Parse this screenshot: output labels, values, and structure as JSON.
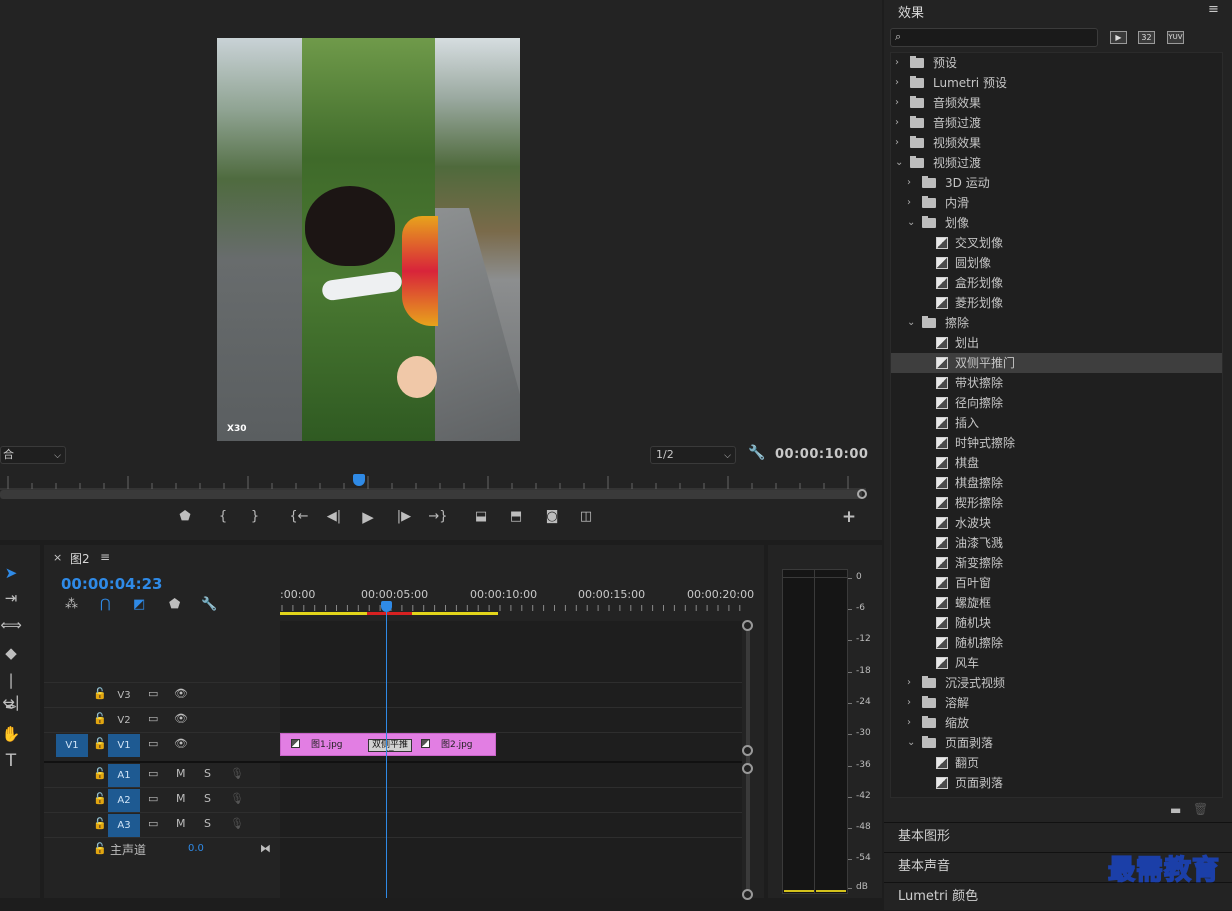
{
  "monitor": {
    "fit_value": "合",
    "resolution_value": "1/2",
    "duration_timecode": "00:00:10:00",
    "watermark": "X30"
  },
  "transport": {
    "buttons": [
      "marker-icon",
      "mark-in-icon",
      "mark-out-icon",
      "go-to-in-icon",
      "step-back-icon",
      "play-icon",
      "step-forward-icon",
      "go-to-out-icon",
      "lift-icon",
      "extract-icon",
      "export-frame-icon",
      "compare-view-icon",
      "add-button-icon"
    ]
  },
  "effects": {
    "title": "效果",
    "badges": [
      "32",
      "YUV"
    ],
    "tree": [
      {
        "label": "预设",
        "level": 0,
        "kind": "star-folder",
        "state": "closed"
      },
      {
        "label": "Lumetri 预设",
        "level": 0,
        "kind": "star-folder",
        "state": "closed"
      },
      {
        "label": "音频效果",
        "level": 0,
        "kind": "folder",
        "state": "closed"
      },
      {
        "label": "音频过渡",
        "level": 0,
        "kind": "folder",
        "state": "closed"
      },
      {
        "label": "视频效果",
        "level": 0,
        "kind": "folder",
        "state": "closed"
      },
      {
        "label": "视频过渡",
        "level": 0,
        "kind": "folder",
        "state": "open"
      },
      {
        "label": "3D 运动",
        "level": 1,
        "kind": "folder",
        "state": "closed"
      },
      {
        "label": "内滑",
        "level": 1,
        "kind": "folder",
        "state": "closed"
      },
      {
        "label": "划像",
        "level": 1,
        "kind": "folder",
        "state": "open"
      },
      {
        "label": "交叉划像",
        "level": 2,
        "kind": "fx"
      },
      {
        "label": "圆划像",
        "level": 2,
        "kind": "fx"
      },
      {
        "label": "盒形划像",
        "level": 2,
        "kind": "fx"
      },
      {
        "label": "菱形划像",
        "level": 2,
        "kind": "fx"
      },
      {
        "label": "擦除",
        "level": 1,
        "kind": "folder",
        "state": "open"
      },
      {
        "label": "划出",
        "level": 2,
        "kind": "fx"
      },
      {
        "label": "双侧平推门",
        "level": 2,
        "kind": "fx",
        "selected": true
      },
      {
        "label": "带状擦除",
        "level": 2,
        "kind": "fx"
      },
      {
        "label": "径向擦除",
        "level": 2,
        "kind": "fx"
      },
      {
        "label": "插入",
        "level": 2,
        "kind": "fx"
      },
      {
        "label": "时钟式擦除",
        "level": 2,
        "kind": "fx"
      },
      {
        "label": "棋盘",
        "level": 2,
        "kind": "fx"
      },
      {
        "label": "棋盘擦除",
        "level": 2,
        "kind": "fx"
      },
      {
        "label": "楔形擦除",
        "level": 2,
        "kind": "fx"
      },
      {
        "label": "水波块",
        "level": 2,
        "kind": "fx"
      },
      {
        "label": "油漆飞溅",
        "level": 2,
        "kind": "fx"
      },
      {
        "label": "渐变擦除",
        "level": 2,
        "kind": "fx"
      },
      {
        "label": "百叶窗",
        "level": 2,
        "kind": "fx"
      },
      {
        "label": "螺旋框",
        "level": 2,
        "kind": "fx"
      },
      {
        "label": "随机块",
        "level": 2,
        "kind": "fx"
      },
      {
        "label": "随机擦除",
        "level": 2,
        "kind": "fx"
      },
      {
        "label": "风车",
        "level": 2,
        "kind": "fx"
      },
      {
        "label": "沉浸式视频",
        "level": 1,
        "kind": "folder",
        "state": "closed"
      },
      {
        "label": "溶解",
        "level": 1,
        "kind": "folder",
        "state": "closed"
      },
      {
        "label": "缩放",
        "level": 1,
        "kind": "folder",
        "state": "closed"
      },
      {
        "label": "页面剥落",
        "level": 1,
        "kind": "folder",
        "state": "open"
      },
      {
        "label": "翻页",
        "level": 2,
        "kind": "fx"
      },
      {
        "label": "页面剥落",
        "level": 2,
        "kind": "fx"
      }
    ],
    "sections": [
      "基本图形",
      "基本声音",
      "Lumetri 颜色"
    ],
    "logo": "最需教育"
  },
  "timeline": {
    "sequence_name": "图2",
    "timecode": "00:00:04:23",
    "ruler_labels": [
      ":00:00",
      "00:00:05:00",
      "00:00:10:00",
      "00:00:15:00",
      "00:00:20:00"
    ],
    "video_tracks": [
      {
        "name": "V3",
        "source": ""
      },
      {
        "name": "V2",
        "source": ""
      },
      {
        "name": "V1",
        "source": "V1"
      }
    ],
    "audio_tracks": [
      {
        "name": "A1",
        "m": "M",
        "s": "S"
      },
      {
        "name": "A2",
        "m": "M",
        "s": "S"
      },
      {
        "name": "A3",
        "m": "M",
        "s": "S"
      }
    ],
    "master": {
      "label": "主声道",
      "value": "0.0"
    },
    "clip1_name": "图1.jpg",
    "clip2_name": "图2.jpg",
    "transition_name": "双侧平推门"
  },
  "meters": {
    "scale": [
      "0",
      "-6",
      "-12",
      "-18",
      "-24",
      "-30",
      "-36",
      "-42",
      "-48",
      "-54",
      "dB"
    ]
  },
  "colors": {
    "accent": "#2f8ae6",
    "clip": "#e27ee3",
    "track_target": "#1e5a92",
    "in_out": "#e3d51b"
  }
}
